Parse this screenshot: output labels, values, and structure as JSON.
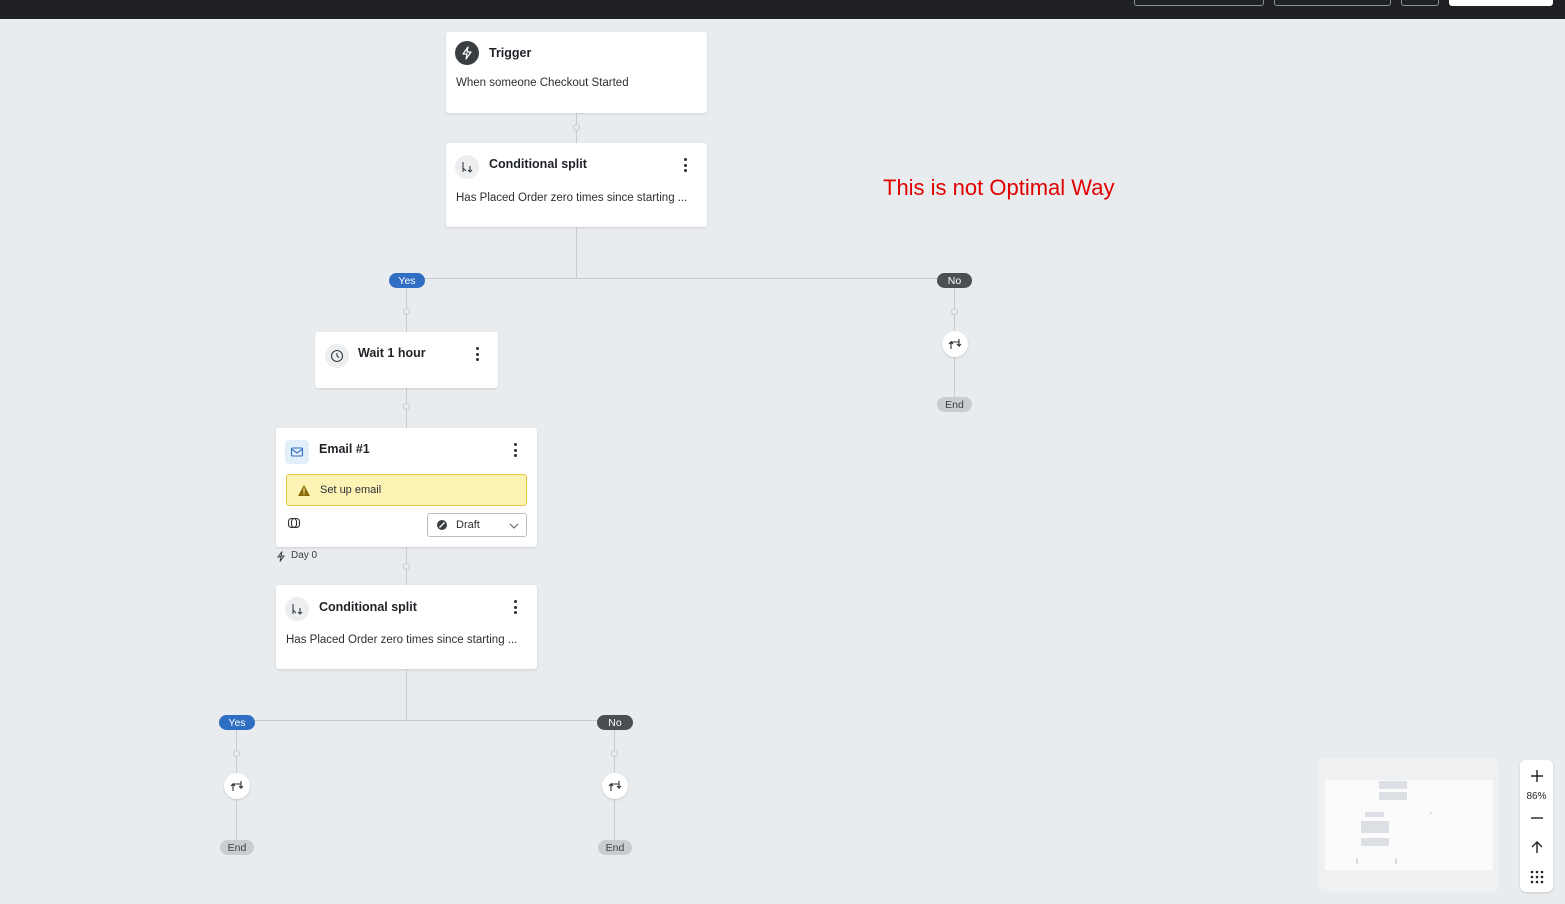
{
  "annotation": "This is not Optimal Way",
  "trigger": {
    "title": "Trigger",
    "description": "When someone Checkout Started",
    "icon": "lightning-icon"
  },
  "split1": {
    "title": "Conditional split",
    "description": "Has Placed Order zero times since starting ...",
    "icon": "split-icon",
    "yes_label": "Yes",
    "no_label": "No"
  },
  "wait": {
    "title": "Wait 1 hour",
    "icon": "clock-icon"
  },
  "email": {
    "title": "Email #1",
    "icon": "envelope-icon",
    "warning": "Set up email",
    "status": "Draft",
    "day_label": "Day 0"
  },
  "split2": {
    "title": "Conditional split",
    "description": "Has Placed Order zero times since starting ...",
    "icon": "split-icon",
    "yes_label": "Yes",
    "no_label": "No"
  },
  "end_label": "End",
  "zoom": {
    "level": "86%"
  },
  "colors": {
    "yes": "#2f6ec2",
    "no": "#4b4f54",
    "warning_bg": "#fdf3b5",
    "annotation": "#e00000"
  }
}
